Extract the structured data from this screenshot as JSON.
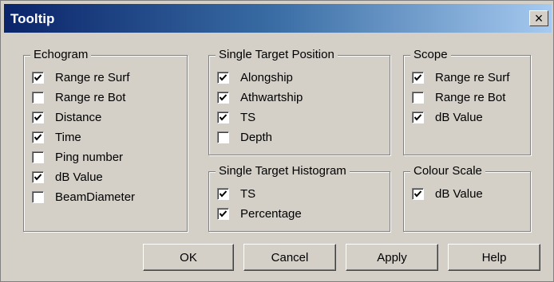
{
  "window": {
    "title": "Tooltip",
    "close_label": "×"
  },
  "groups": {
    "echogram": {
      "label": "Echogram",
      "items": [
        {
          "label": "Range re Surf",
          "checked": true
        },
        {
          "label": "Range re Bot",
          "checked": false
        },
        {
          "label": "Distance",
          "checked": true
        },
        {
          "label": "Time",
          "checked": true
        },
        {
          "label": "Ping number",
          "checked": false
        },
        {
          "label": "dB Value",
          "checked": true
        },
        {
          "label": "BeamDiameter",
          "checked": false
        }
      ]
    },
    "single_target_position": {
      "label": "Single Target Position",
      "items": [
        {
          "label": "Alongship",
          "checked": true
        },
        {
          "label": "Athwartship",
          "checked": true
        },
        {
          "label": "TS",
          "checked": true
        },
        {
          "label": "Depth",
          "checked": false
        }
      ]
    },
    "single_target_histogram": {
      "label": "Single Target Histogram",
      "items": [
        {
          "label": "TS",
          "checked": true
        },
        {
          "label": "Percentage",
          "checked": true
        }
      ]
    },
    "scope": {
      "label": "Scope",
      "items": [
        {
          "label": "Range re Surf",
          "checked": true
        },
        {
          "label": "Range re Bot",
          "checked": false
        },
        {
          "label": "dB Value",
          "checked": true
        }
      ]
    },
    "colour_scale": {
      "label": "Colour Scale",
      "items": [
        {
          "label": "dB Value",
          "checked": true
        }
      ]
    }
  },
  "buttons": {
    "ok": "OK",
    "cancel": "Cancel",
    "apply": "Apply",
    "help": "Help"
  }
}
